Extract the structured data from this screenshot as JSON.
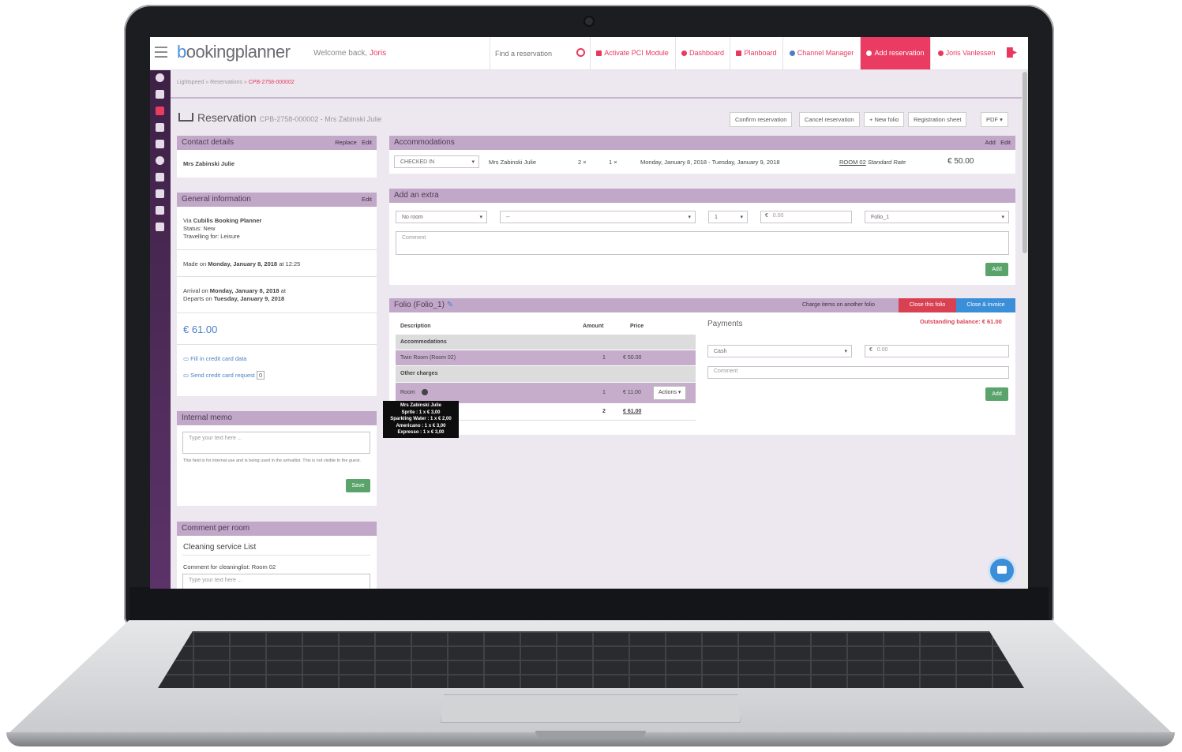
{
  "topbar": {
    "brand_first": "b",
    "brand_rest": "ookingplanner",
    "welcome": "Welcome back, ",
    "user_first": "Joris",
    "search_placeholder": "Find a reservation",
    "nav": {
      "pci": "Activate PCI Module",
      "dashboard": "Dashboard",
      "planboard": "Planboard",
      "channel_manager": "Channel Manager",
      "add_reservation": "Add reservation",
      "user": "Joris Vanlessen"
    }
  },
  "breadcrumb": {
    "b1": "Lightspeed",
    "sep": "»",
    "b2": "Reservations",
    "b3": "CPB-2758-000002"
  },
  "page": {
    "title": "Reservation",
    "subtitle": "CPB-2758-000002 - Mrs Zabinski Julie"
  },
  "toolbar": {
    "confirm": "Confirm reservation",
    "cancel": "Cancel reservation",
    "new_folio": "+ New folio",
    "registration": "Registration sheet",
    "pdf": "PDF ▾"
  },
  "contact": {
    "title": "Contact details",
    "replace": "Replace",
    "edit": "Edit",
    "name": "Mrs Zabinski Julie"
  },
  "general": {
    "title": "General information",
    "edit": "Edit",
    "via_label": "Via ",
    "via": "Cubilis Booking Planner",
    "status": "Status: New",
    "travelling": "Travelling for: Leisure",
    "made_label": "Made on ",
    "made_date": "Monday, January 8, 2018",
    "made_time": " at 12:25",
    "arrival_label": "Arrival on ",
    "arrival_date": "Monday, January 8, 2018",
    "arrival_suffix": " at",
    "departs_label": "Departs on ",
    "departs_date": "Tuesday, January 9, 2018",
    "total": "€ 61.00",
    "fill_cc": "Fill in credit card data",
    "send_cc": "Send credit card request",
    "send_cc_count": "0"
  },
  "memo": {
    "title": "Internal memo",
    "placeholder": "Type your text here ...",
    "hint": "This field is for internal use and is being used in the arrivallist. This is not visible to the guest.",
    "save": "Save"
  },
  "comment_room": {
    "title": "Comment per room",
    "subtitle": "Cleaning service List",
    "label": "Comment for cleaninglist: Room 02",
    "placeholder": "Type your text here ..."
  },
  "accommodations": {
    "title": "Accommodations",
    "add": "Add",
    "edit": "Edit",
    "status": "CHECKED IN",
    "guest": "Mrs Zabinski Julie",
    "adults": "2 ×",
    "children": "1 ×",
    "dates": "Monday, January 8, 2018 - Tuesday, January 9, 2018",
    "room": "ROOM 02",
    "rate": "Standard Rate",
    "price": "€ 50.00"
  },
  "extra": {
    "title": "Add an extra",
    "room": "No room",
    "item": "--",
    "qty": "1",
    "currency": "€",
    "amount_placeholder": "0.00",
    "folio": "Folio_1",
    "comment_placeholder": "Comment",
    "add": "Add"
  },
  "folio": {
    "title": "Folio (Folio_1)",
    "charge_other": "Charge items on another folio",
    "close_folio": "Close this folio",
    "close_invoice": "Close & invoice",
    "headers": {
      "description": "Description",
      "amount": "Amount",
      "price": "Price"
    },
    "group_accommodations": "Accommodations",
    "row1": {
      "description": "Twin Room (Room 02)",
      "amount": "1",
      "price": "€ 50.00"
    },
    "group_other": "Other charges",
    "row2": {
      "description": "Room",
      "amount": "1",
      "price": "€ 11.00",
      "actions": "Actions ▾"
    },
    "total": {
      "amount": "2",
      "price": "€ 61.00"
    },
    "tooltip": {
      "l1": "Mrs Zabinski Julie",
      "l2": "Sprite : 1 x € 3,00",
      "l3": "Sparkling Water : 1 x € 2,00",
      "l4": "Americano : 1 x € 3,00",
      "l5": "Expresso : 1 x € 3,00"
    },
    "payments": {
      "title": "Payments",
      "balance": "Outstanding balance: € 61.00",
      "method": "Cash",
      "currency": "€",
      "amount_placeholder": "0.00",
      "comment_placeholder": "Comment",
      "add": "Add"
    }
  },
  "colors": {
    "accent": "#ea3b63",
    "panel_header": "#c2a8c8",
    "sidebar": "#4a2855",
    "blue": "#3a8fd8",
    "green": "#5aa46c",
    "red": "#d94052"
  }
}
